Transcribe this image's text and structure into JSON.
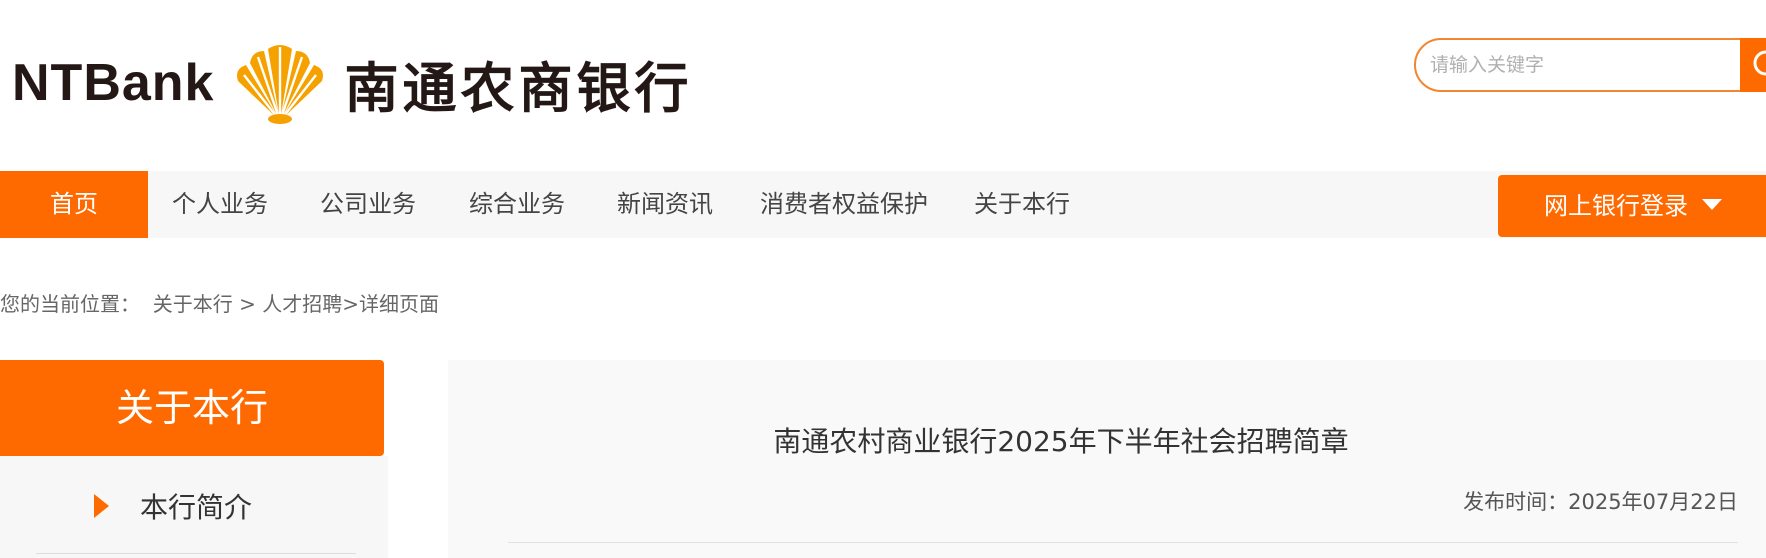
{
  "header": {
    "logo_latin": "NTBank",
    "logo_cn": "南通农商银行",
    "search_placeholder": "请输入关键字"
  },
  "nav": {
    "items": [
      {
        "label": "首页",
        "active": true
      },
      {
        "label": "个人业务"
      },
      {
        "label": "公司业务"
      },
      {
        "label": "综合业务"
      },
      {
        "label": "新闻资讯"
      },
      {
        "label": "消费者权益保护"
      },
      {
        "label": "关于本行"
      }
    ],
    "login_label": "网上银行登录"
  },
  "breadcrumb": {
    "prefix": "您的当前位置：",
    "crumb1": "关于本行",
    "separator": ">",
    "crumb2": "人才招聘",
    "crumb3": "详细页面"
  },
  "sidebar": {
    "title": "关于本行",
    "items": [
      {
        "label": "本行简介"
      }
    ]
  },
  "article": {
    "title": "南通农村商业银行2025年下半年社会招聘简章",
    "publish_label": "发布时间：",
    "publish_date": "2025年07月22日"
  },
  "colors": {
    "brand_orange": "#ff6a00",
    "logo_gold": "#f5a200",
    "nav_bg": "#f7f7f7"
  },
  "icons": {
    "search": "search-icon",
    "login_dropdown": "caret-down-icon",
    "sidebar_bullet": "triangle-right-icon",
    "logo": "shell-logo-icon"
  }
}
